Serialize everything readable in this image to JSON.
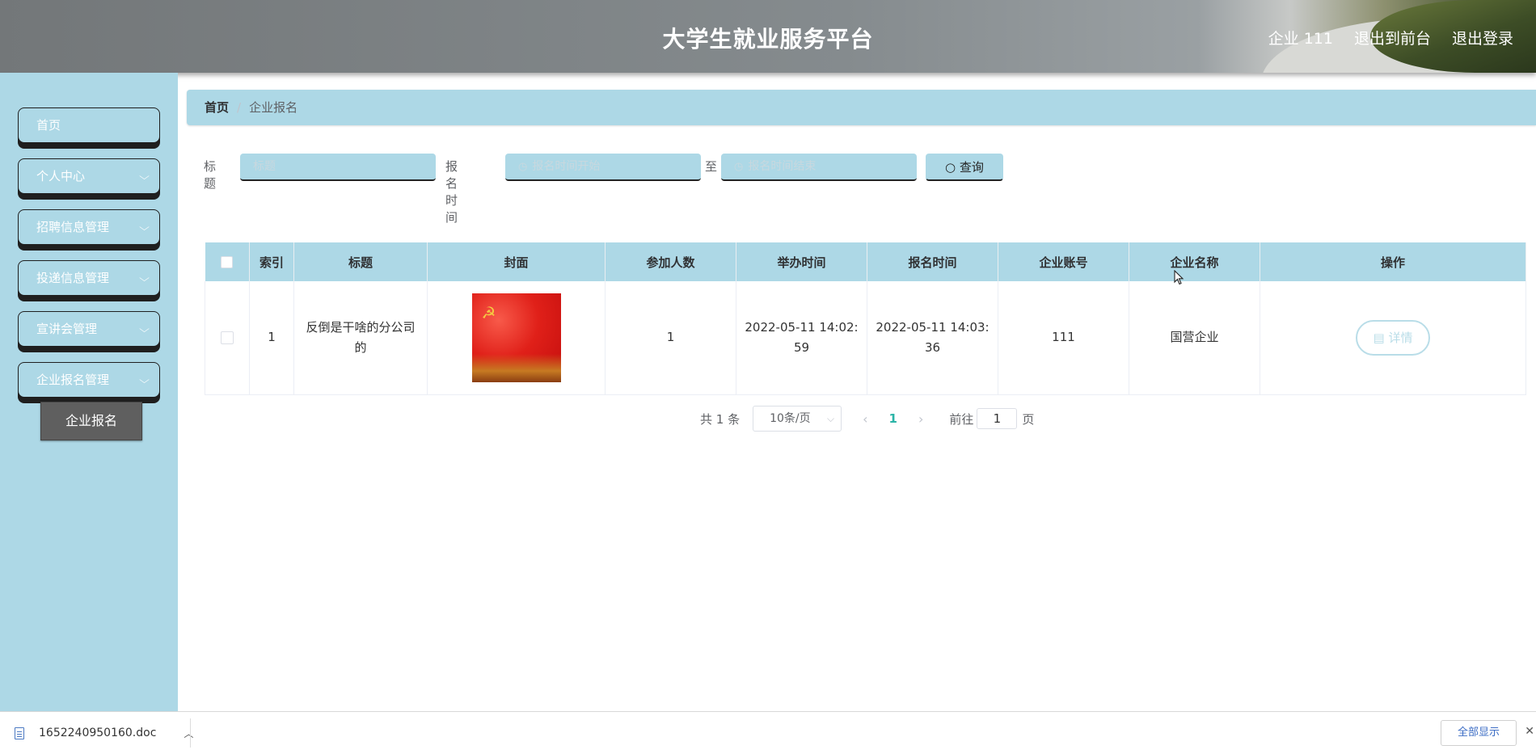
{
  "header": {
    "title": "大学生就业服务平台",
    "user_label": "企业 111",
    "front_label": "退出到前台",
    "logout_label": "退出登录"
  },
  "sidebar": {
    "items": [
      {
        "label": "首页",
        "expandable": false
      },
      {
        "label": "个人中心",
        "expandable": true
      },
      {
        "label": "招聘信息管理",
        "expandable": true
      },
      {
        "label": "投递信息管理",
        "expandable": true
      },
      {
        "label": "宣讲会管理",
        "expandable": true
      },
      {
        "label": "企业报名管理",
        "expandable": true
      }
    ],
    "active_sub": "企业报名"
  },
  "breadcrumb": {
    "home": "首页",
    "separator": "/",
    "current": "企业报名"
  },
  "search": {
    "title_label": "标题",
    "title_placeholder": "标题",
    "date_label": "报名时间",
    "start_placeholder": "报名时间开始",
    "to_label": "至",
    "end_placeholder": "报名时间结束",
    "query_label": "查询"
  },
  "table": {
    "columns": [
      "索引",
      "标题",
      "封面",
      "参加人数",
      "举办时间",
      "报名时间",
      "企业账号",
      "企业名称",
      "操作"
    ],
    "rows": [
      {
        "index": "1",
        "title": "反倒是干啥的分公司的",
        "participants": "1",
        "hold_time": "2022-05-11 14:02:59",
        "signup_time": "2022-05-11 14:03:36",
        "account": "111",
        "company": "国营企业",
        "action_label": "详情"
      }
    ]
  },
  "pagination": {
    "total_label": "共 1 条",
    "page_size": "10条/页",
    "current_page": "1",
    "goto_label": "前往",
    "goto_value": "1",
    "page_suffix": "页"
  },
  "download_bar": {
    "file_name": "1652240950160.doc",
    "show_all_label": "全部显示"
  },
  "colors": {
    "accent": "#add8e6",
    "header_bg": "#7d8285",
    "active_submenu": "#5f5f5f",
    "page_active": "#2bb4a7"
  }
}
